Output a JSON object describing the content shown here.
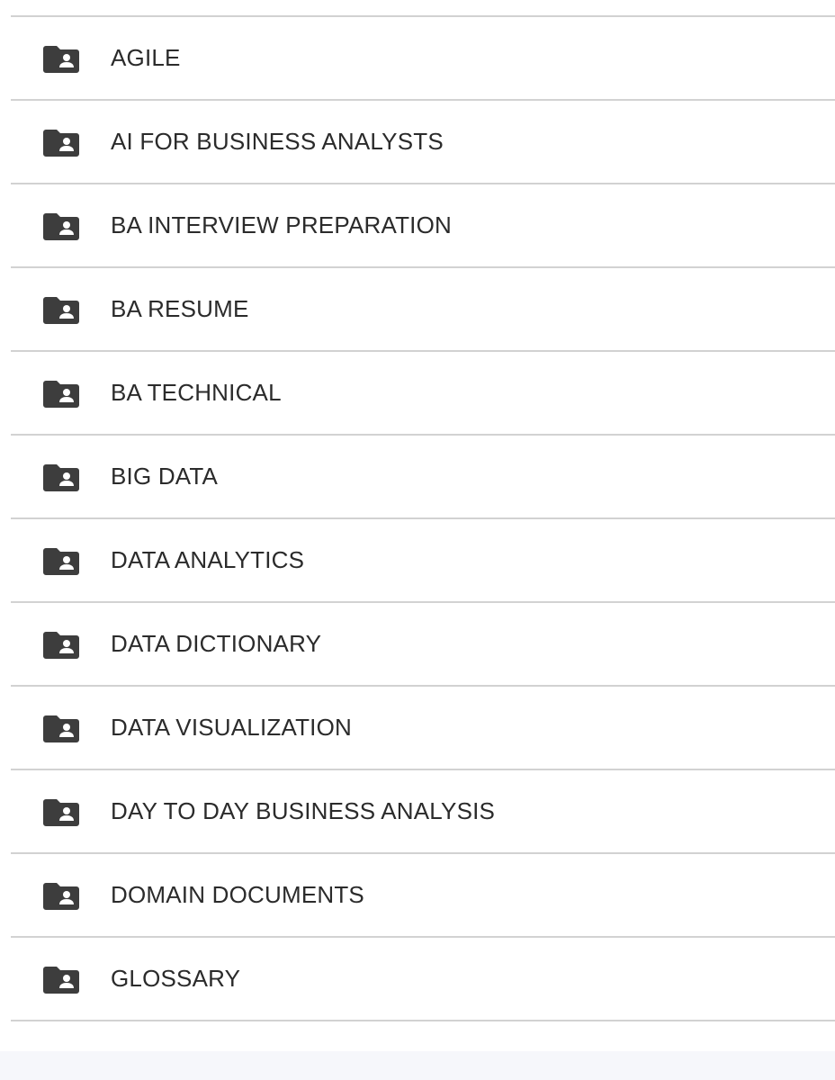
{
  "folders": {
    "icon": "shared-folder-icon",
    "icon_color": "#3d3d3d",
    "items": [
      {
        "label": "AGILE"
      },
      {
        "label": "AI FOR BUSINESS ANALYSTS"
      },
      {
        "label": "BA INTERVIEW PREPARATION"
      },
      {
        "label": "BA RESUME"
      },
      {
        "label": "BA TECHNICAL"
      },
      {
        "label": "BIG DATA"
      },
      {
        "label": "DATA ANALYTICS"
      },
      {
        "label": "DATA DICTIONARY"
      },
      {
        "label": "DATA VISUALIZATION"
      },
      {
        "label": "DAY TO DAY BUSINESS ANALYSIS"
      },
      {
        "label": "DOMAIN DOCUMENTS"
      },
      {
        "label": "GLOSSARY"
      }
    ]
  }
}
